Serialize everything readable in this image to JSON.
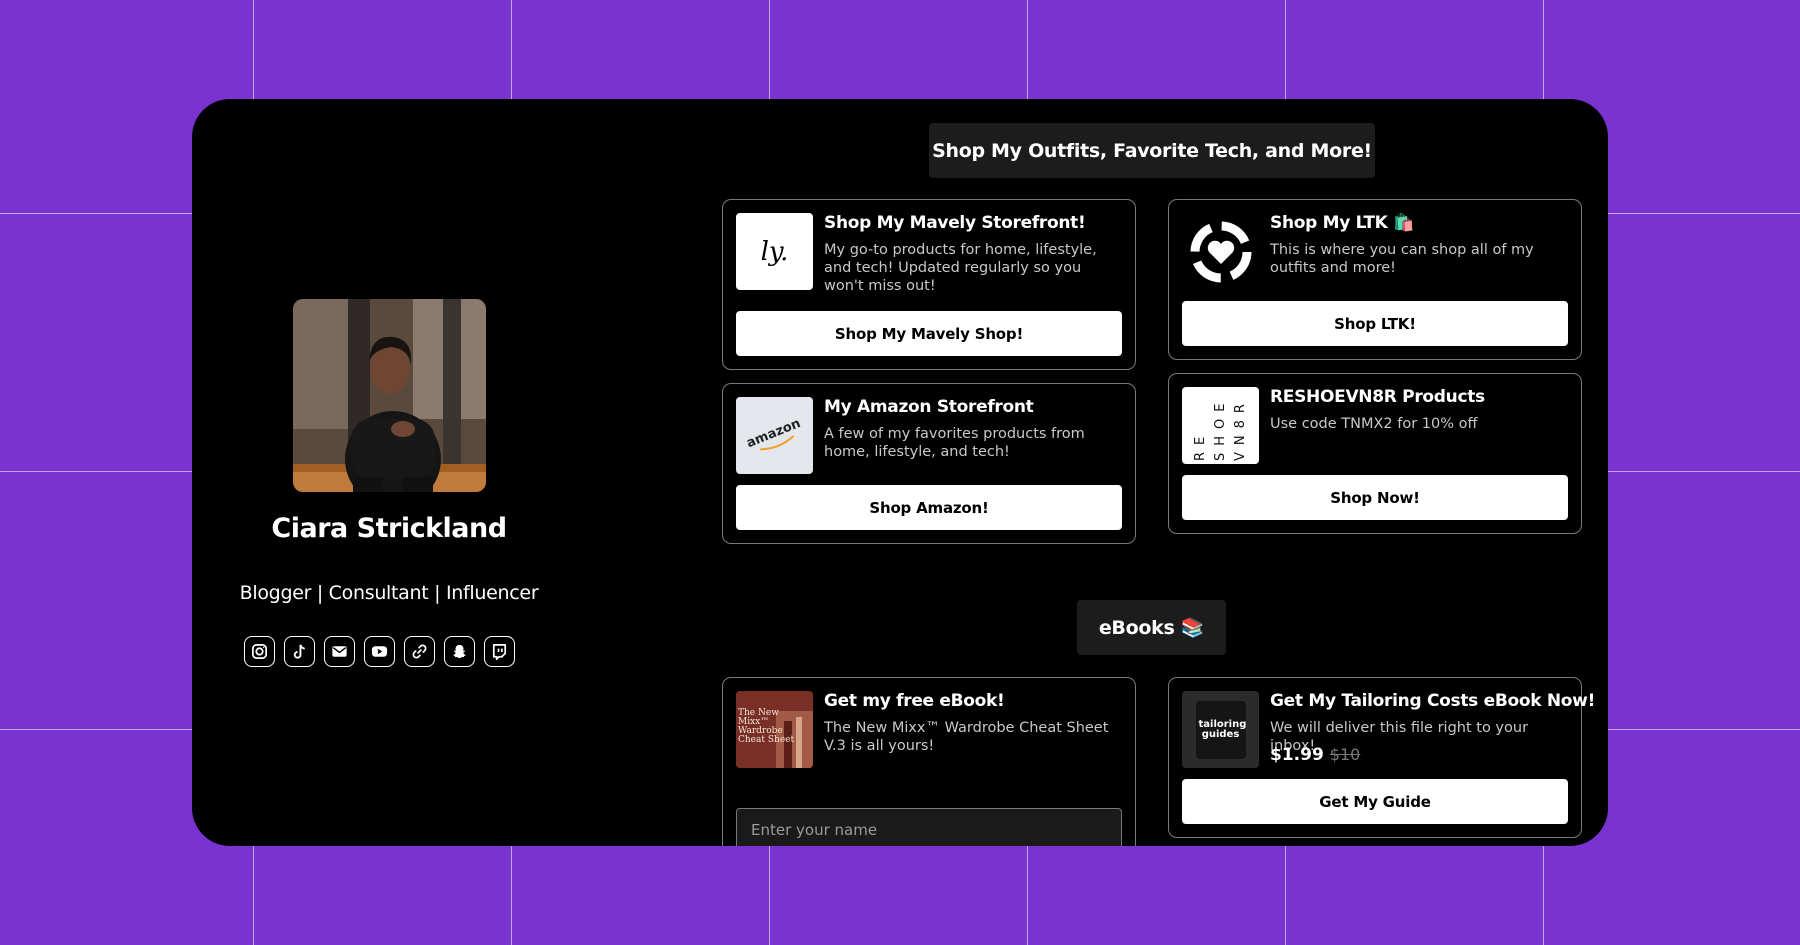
{
  "profile": {
    "name": "Ciara Strickland",
    "tagline": "Blogger | Consultant | Influencer",
    "socials": [
      "instagram-icon",
      "tiktok-icon",
      "email-icon",
      "youtube-icon",
      "link-icon",
      "snapchat-icon",
      "twitch-icon"
    ]
  },
  "shop_section": {
    "heading": "Shop My Outfits, Favorite Tech, and More!",
    "cards": [
      {
        "title": "Shop My Mavely Storefront!",
        "description": "My go-to products for home, lifestyle, and tech! Updated regularly so you won't miss out!",
        "thumb_text": "ly.",
        "button": "Shop My Mavely Shop!"
      },
      {
        "title": "Shop My LTK 🛍️",
        "description": "This is where you can shop all of my outfits and more!",
        "button": "Shop LTK!"
      },
      {
        "title": "My Amazon Storefront",
        "description": "A few of my favorites products from home, lifestyle, and tech!",
        "thumb_text": "amazon",
        "button": "Shop Amazon!"
      },
      {
        "title": "RESHOEVN8R Products",
        "description": "Use code TNMX2 for 10% off",
        "thumb_text": "RE SHOE VN8R",
        "button": "Shop Now!"
      }
    ]
  },
  "ebooks_section": {
    "heading": "eBooks 📚",
    "cards": [
      {
        "title": "Get my free eBook!",
        "description": "The New Mixx™ Wardrobe Cheat Sheet V.3 is all yours!",
        "thumb_text": "The New Mixx™ Wardrobe Cheat Sheet",
        "input_placeholder": "Enter your name"
      },
      {
        "title": "Get My Tailoring Costs eBook Now!",
        "description": "We will deliver this file right to your inbox!",
        "thumb_text": "tailoring guides",
        "price": "$1.99",
        "price_old": "$10",
        "button": "Get My Guide"
      }
    ]
  },
  "colors": {
    "background": "#7b33cf",
    "frame": "#000000",
    "button": "#ffffff",
    "pill": "#1c1c1c"
  }
}
